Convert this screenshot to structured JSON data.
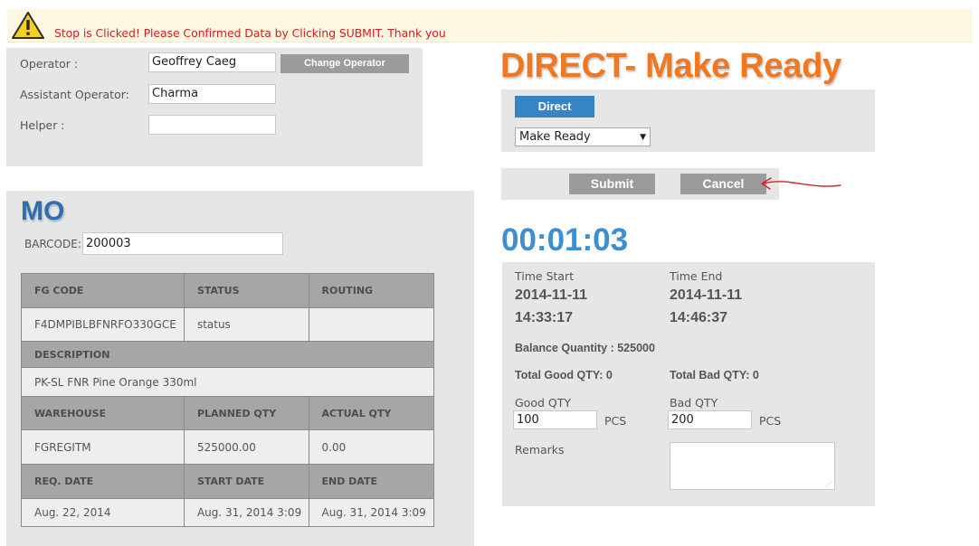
{
  "alert": {
    "icon": "warning-icon",
    "message": "Stop is Clicked! Please Confirmed Data by Clicking SUBMIT. Thank you",
    "color": "#d42020"
  },
  "operators": {
    "operator_label": "Operator :",
    "operator_value": "Geoffrey Caeg",
    "change_operator_label": "Change Operator",
    "assistant_label": "Assistant Operator:",
    "assistant_value": "Charma",
    "helper_label": "Helper :",
    "helper_value": ""
  },
  "mo": {
    "title": "MO",
    "barcode_label": "BARCODE:",
    "barcode_value": "200003",
    "headers1": [
      "FG CODE",
      "STATUS",
      "ROUTING"
    ],
    "row1": [
      "F4DMPIBLBFNRFO330GCE",
      "status",
      ""
    ],
    "description_label": "DESCRIPTION",
    "description_value": "PK-SL FNR Pine Orange 330ml",
    "headers2": [
      "WAREHOUSE",
      "PLANNED QTY",
      "ACTUAL QTY"
    ],
    "row2": [
      "FGREGITM",
      "525000.00",
      "0.00"
    ],
    "headers3": [
      "REQ. DATE",
      "START DATE",
      "END DATE"
    ],
    "row3": [
      "Aug. 22, 2014",
      "Aug. 31, 2014 3:09",
      "Aug. 31, 2014 3:09"
    ]
  },
  "direct": {
    "title": "DIRECT- Make Ready",
    "direct_button": "Direct",
    "mode_selected": "Make Ready",
    "submit_label": "Submit",
    "cancel_label": "Cancel"
  },
  "timer": "00:01:03",
  "details": {
    "time_start_label": "Time Start",
    "time_start_date": "2014-11-11",
    "time_start_time": "14:33:17",
    "time_end_label": "Time End",
    "time_end_date": "2014-11-11",
    "time_end_time": "14:46:37",
    "balance_quantity": "Balance Quantity : 525000",
    "total_good": "Total Good QTY: 0",
    "total_bad": "Total Bad QTY: 0",
    "good_qty_label": "Good QTY",
    "good_qty_value": "100",
    "bad_qty_label": "Bad QTY",
    "bad_qty_value": "200",
    "unit": "PCS",
    "remarks_label": "Remarks",
    "remarks_value": ""
  },
  "colors": {
    "accent_blue": "#3784c4",
    "accent_orange": "#f07822",
    "mo_blue": "#2f6fb1",
    "timer_blue": "#3d8fd0"
  }
}
